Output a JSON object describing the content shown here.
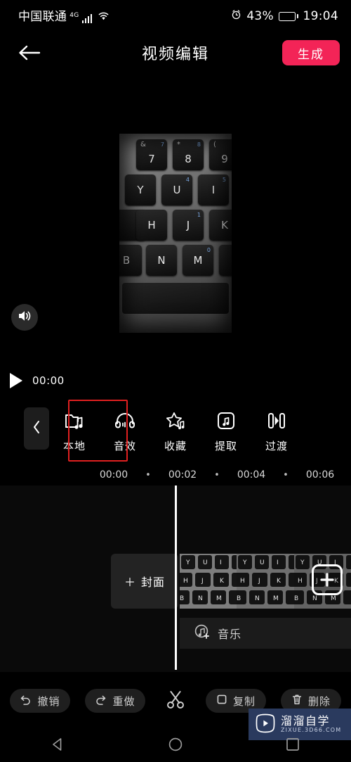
{
  "status_bar": {
    "carrier": "中国联通",
    "network_type": "4G",
    "signal_icon": "signal-bars-icon",
    "wifi_icon": "wifi-icon",
    "alarm_icon": "alarm-clock-icon",
    "battery_percent": "43%",
    "battery_icon": "battery-icon",
    "time": "19:04"
  },
  "header": {
    "back_icon": "back-arrow-icon",
    "title": "视频编辑",
    "generate_label": "生成",
    "generate_color": "#F32457"
  },
  "preview": {
    "volume_icon": "speaker-volume-icon",
    "video_content": "laptop keyboard close-up"
  },
  "player": {
    "play_icon": "play-icon",
    "current_time": "00:00"
  },
  "toolbar": {
    "collapse_icon": "chevron-left-icon",
    "highlight_color": "#E02020",
    "highlighted_index": 0,
    "items": [
      {
        "label": "本地",
        "icon": "folder-music-icon"
      },
      {
        "label": "音效",
        "icon": "headphones-icon"
      },
      {
        "label": "收藏",
        "icon": "star-music-icon"
      },
      {
        "label": "提取",
        "icon": "extract-audio-icon"
      },
      {
        "label": "过渡",
        "icon": "transition-icon"
      }
    ]
  },
  "timeline": {
    "ruler_ticks": [
      "00:00",
      "00:02",
      "00:04",
      "00:06"
    ],
    "tick_separator": "•",
    "cover_label": "封面",
    "cover_plus": "＋",
    "add_clip_icon": "plus-icon",
    "music_label": "音乐",
    "music_icon": "add-music-icon",
    "playhead": "playhead-indicator"
  },
  "bottom_bar": {
    "undo_label": "撤销",
    "undo_icon": "undo-icon",
    "redo_label": "重做",
    "redo_icon": "redo-icon",
    "cut_icon": "scissors-icon",
    "copy_label": "复制",
    "copy_icon": "copy-icon",
    "delete_label": "删除",
    "delete_icon": "trash-icon"
  },
  "watermark": {
    "logo_icon": "play-logo-icon",
    "cn_text": "溜溜自学",
    "en_text": "ZIXUE.3D66.COM",
    "bg_color": "#2A3A5E"
  },
  "nav_bar": {
    "back_icon": "nav-back-triangle-icon",
    "home_icon": "nav-home-circle-icon",
    "recents_icon": "nav-recents-square-icon"
  },
  "keyboard_keys": {
    "row1": [
      "&7",
      "*8",
      "(9"
    ],
    "row2": [
      "Y",
      "U",
      "I"
    ],
    "row3": [
      "H",
      "J",
      "K"
    ],
    "row4": [
      "B",
      "N",
      "M"
    ]
  }
}
